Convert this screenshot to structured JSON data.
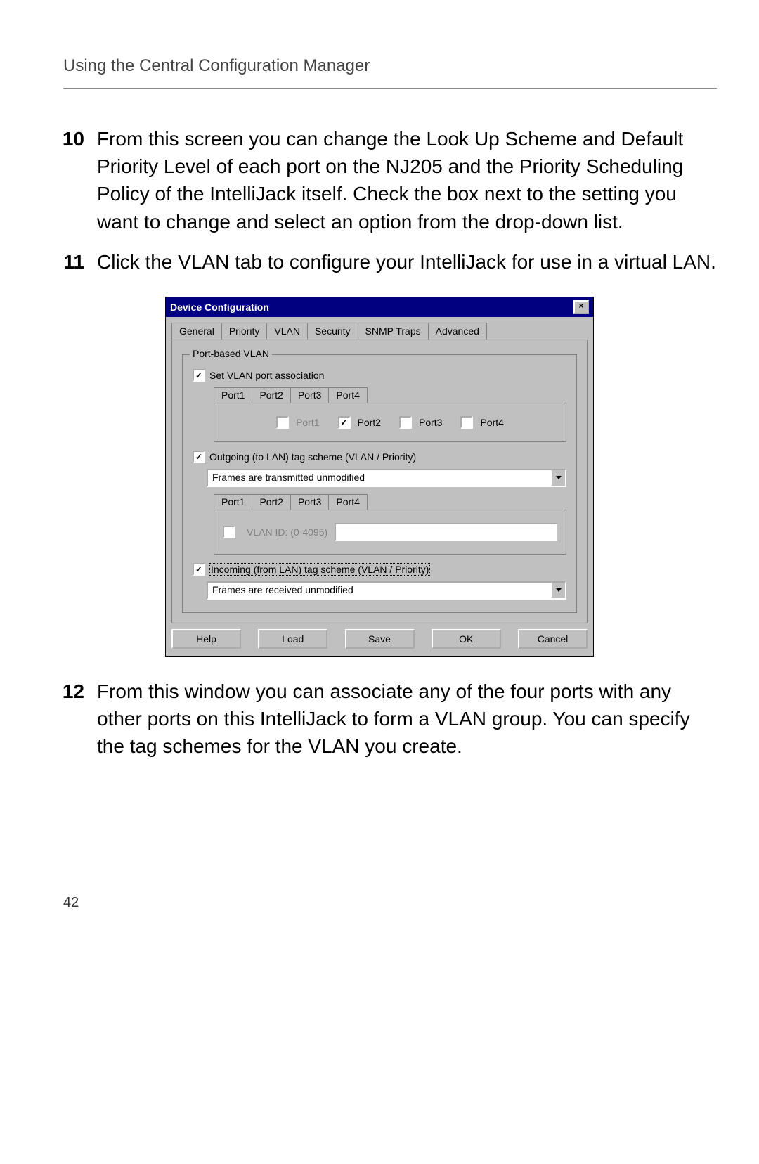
{
  "header": "Using the Central Configuration Manager",
  "page_number": "42",
  "steps": [
    {
      "num": "10",
      "text": "From this screen you can change the Look Up Scheme and Default Priority Level of each port on the NJ205 and the Priority Scheduling Policy of the IntelliJack itself. Check the box next to the setting you want to change and select an option from the drop-down list."
    },
    {
      "num": "11",
      "text": "Click the VLAN tab to configure your IntelliJack for use in a virtual LAN."
    },
    {
      "num": "12",
      "text": "From this window you can associate any of the four ports with any other ports on this IntelliJack to form a VLAN group. You can specify the tag schemes for the VLAN you create."
    }
  ],
  "dialog": {
    "title": "Device Configuration",
    "tabs": [
      "General",
      "Priority",
      "VLAN",
      "Security",
      "SNMP Traps",
      "Advanced"
    ],
    "active_tab": 2,
    "groupbox_title": "Port-based VLAN",
    "set_vlan_label": "Set VLAN port association",
    "port_tabs": [
      "Port1",
      "Port2",
      "Port3",
      "Port4"
    ],
    "assoc_ports": [
      {
        "label": "Port1",
        "checked": false,
        "disabled": true
      },
      {
        "label": "Port2",
        "checked": true,
        "disabled": false
      },
      {
        "label": "Port3",
        "checked": false,
        "disabled": false
      },
      {
        "label": "Port4",
        "checked": false,
        "disabled": false
      }
    ],
    "outgoing_label": "Outgoing (to LAN) tag scheme (VLAN / Priority)",
    "outgoing_value": "Frames are transmitted unmodified",
    "vlan_id_label": "VLAN ID:  (0-4095)",
    "incoming_label": "Incoming (from LAN) tag scheme (VLAN / Priority)",
    "incoming_value": "Frames are received unmodified",
    "buttons": [
      "Help",
      "Load",
      "Save",
      "OK",
      "Cancel"
    ]
  }
}
